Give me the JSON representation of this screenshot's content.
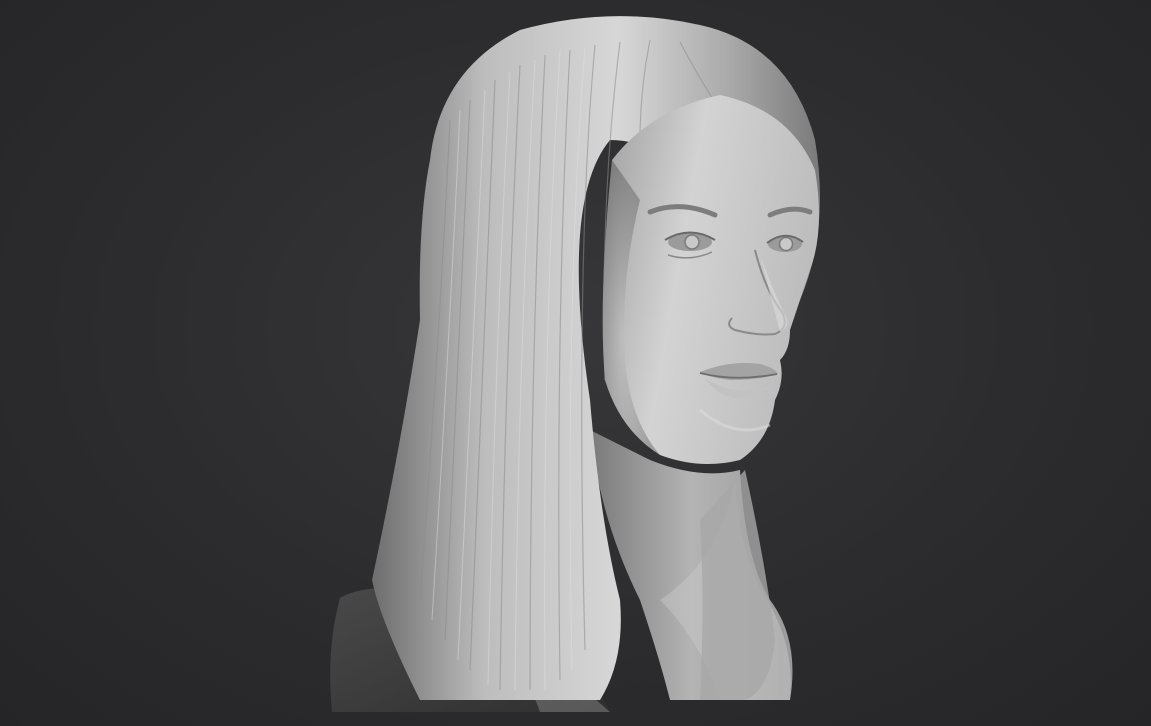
{
  "scene": {
    "subject": "sculpted-bust",
    "background_color": "#2a2a2c",
    "material_color": "#b9b9b9",
    "shadow_color": "#3a3a3a"
  }
}
